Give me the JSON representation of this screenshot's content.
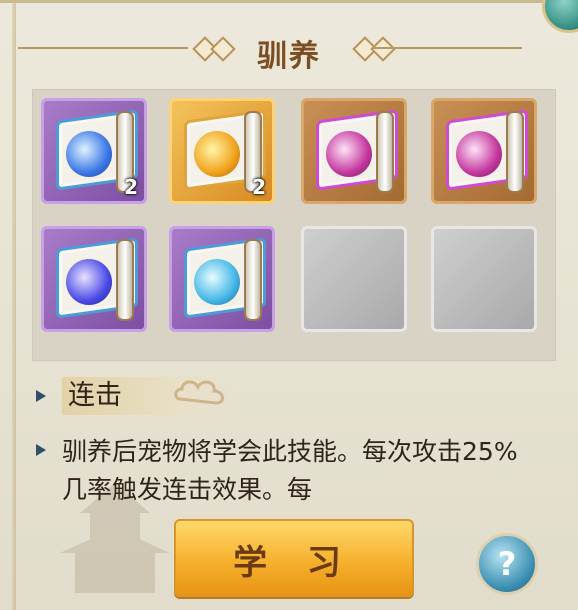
{
  "title": "驯养",
  "slots": [
    {
      "frame": "purple",
      "orb": "blue",
      "edge": "blue-edge",
      "count": "2"
    },
    {
      "frame": "orange",
      "orb": "gold",
      "edge": "gold-edge",
      "count": "2"
    },
    {
      "frame": "brown",
      "orb": "pink",
      "edge": "pink-edge",
      "count": ""
    },
    {
      "frame": "brown",
      "orb": "pink",
      "edge": "pink-edge",
      "count": ""
    },
    {
      "frame": "purple",
      "orb": "violet",
      "edge": "blue-edge",
      "count": ""
    },
    {
      "frame": "purple",
      "orb": "cyan",
      "edge": "blue-edge",
      "count": ""
    },
    {
      "frame": "empty",
      "orb": "",
      "edge": "",
      "count": ""
    },
    {
      "frame": "empty",
      "orb": "",
      "edge": "",
      "count": ""
    }
  ],
  "skill_name": "连击",
  "description": "驯养后宠物将学会此技能。每次攻击25%几率触发连击效果。每",
  "learn_button": "学 习",
  "help_button": "?"
}
